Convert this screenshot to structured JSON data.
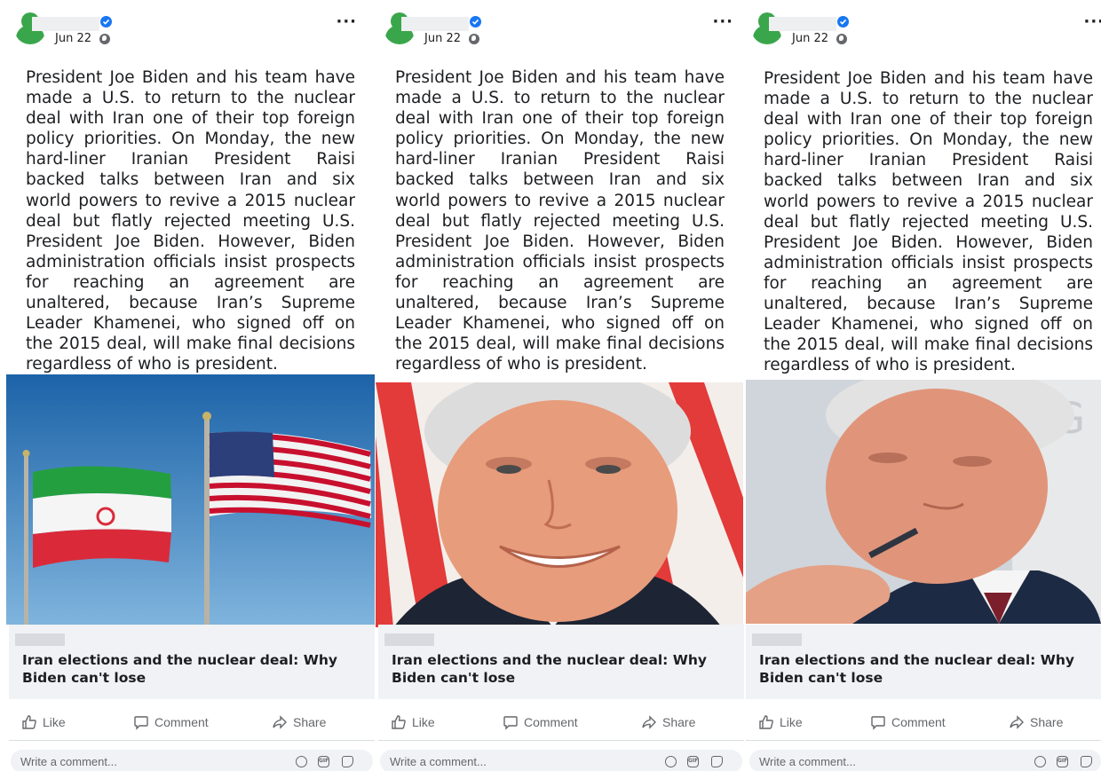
{
  "posts": [
    {
      "date": "Jun 22",
      "text": "President Joe Biden and his team have made a U.S. to return to the nuclear deal with Iran one of their top foreign policy priorities. On Monday, the new hard-liner Iranian President Raisi backed talks between Iran and six world powers to revive a 2015 nuclear deal but flatly rejected meeting U.S. President Joe Biden. However, Biden administration officials insist prospects for reaching an agreement are unaltered, because Iran’s Supreme Leader Khamenei, who signed off on the 2015 deal, will make final decisions regardless of who is president.",
      "image": "iran-us-flags",
      "headline": "Iran elections and the nuclear deal: Why Biden can't lose",
      "actions": {
        "like": "Like",
        "comment": "Comment",
        "share": "Share"
      },
      "comment_placeholder": "Write a comment..."
    },
    {
      "date": "Jun 22",
      "text": "President Joe Biden and his team have made a U.S. to return to the nuclear deal with Iran one of their top foreign policy priorities. On Monday, the new hard-liner Iranian President Raisi backed talks between Iran and six world powers to revive a 2015 nuclear deal but flatly rejected meeting U.S. President Joe Biden. However, Biden administration officials insist prospects for reaching an agreement are unaltered, because Iran’s Supreme Leader Khamenei, who signed off on the 2015 deal, will make final decisions regardless of who is president.",
      "image": "biden-smiling",
      "headline": "Iran elections and the nuclear deal: Why Biden can't lose",
      "actions": {
        "like": "Like",
        "comment": "Comment",
        "share": "Share"
      },
      "comment_placeholder": "Write a comment..."
    },
    {
      "date": "Jun 22",
      "text": "President Joe Biden and his team have made a U.S. to return to the nuclear deal with Iran one of their top foreign policy priorities. On Monday, the new hard-liner Iranian President Raisi backed talks between Iran and six world powers to revive a 2015 nuclear deal but flatly rejected meeting U.S. President Joe Biden. However, Biden administration officials insist prospects for reaching an agreement are unaltered, because Iran’s Supreme Leader Khamenei, who signed off on the 2015 deal, will make final decisions regardless of who is president.",
      "image": "biden-pensive",
      "headline": "Iran elections and the nuclear deal: Why Biden can't lose",
      "actions": {
        "like": "Like",
        "comment": "Comment",
        "share": "Share"
      },
      "comment_placeholder": "Write a comment..."
    }
  ],
  "colors": {
    "verified": "#1877f2",
    "avatar": "#3aa64b",
    "preview_bg": "#f0f2f5",
    "muted": "#65676b"
  }
}
